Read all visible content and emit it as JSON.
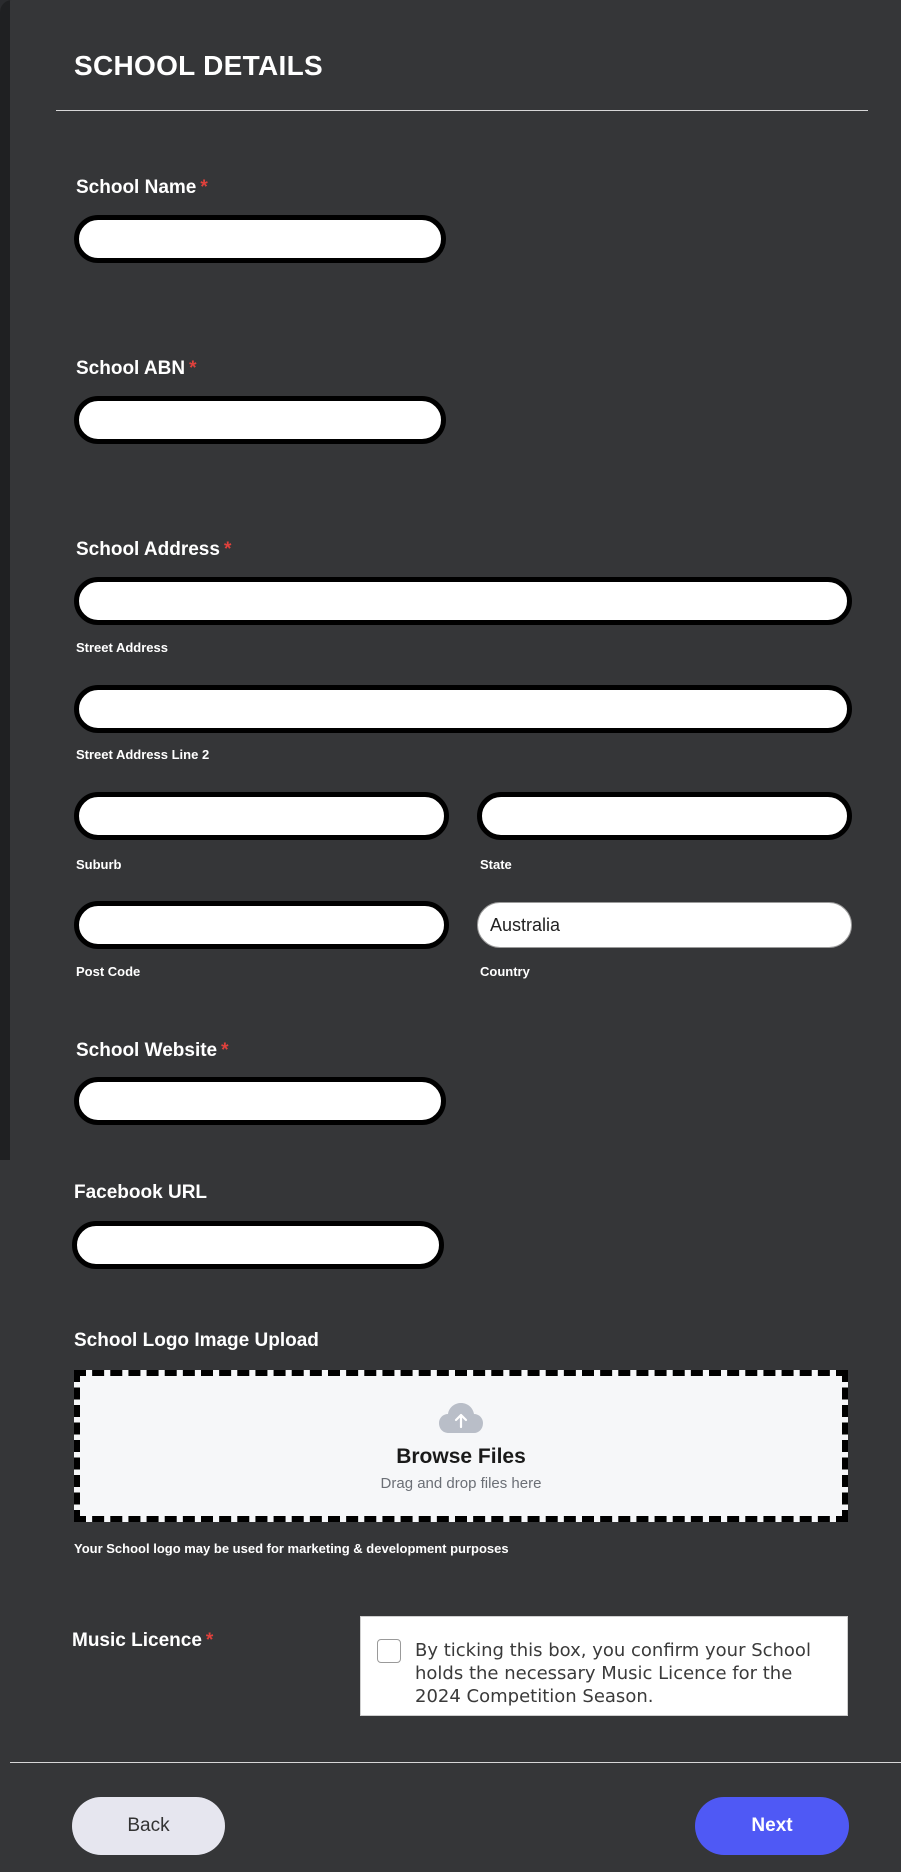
{
  "section": {
    "title": "SCHOOL DETAILS"
  },
  "school_name": {
    "label": "School Name",
    "required": "*",
    "value": ""
  },
  "school_abn": {
    "label": "School ABN",
    "required": "*",
    "value": ""
  },
  "school_address": {
    "label": "School Address",
    "required": "*",
    "street_label": "Street Address",
    "street2_label": "Street Address Line 2",
    "suburb_label": "Suburb",
    "state_label": "State",
    "postcode_label": "Post Code",
    "country_label": "Country",
    "country_value": "Australia"
  },
  "school_website": {
    "label": "School Website",
    "required": "*",
    "value": ""
  },
  "facebook_url": {
    "label": "Facebook URL",
    "value": ""
  },
  "logo_upload": {
    "label": "School Logo Image Upload",
    "browse_label": "Browse Files",
    "drag_label": "Drag and drop files here",
    "note": "Your School logo may be used for marketing & development purposes",
    "icon": "cloud-upload-icon"
  },
  "music_licence": {
    "label": "Music Licence",
    "required": "*",
    "checkbox_text": "By ticking this box, you confirm your School holds the necessary Music Licence for the 2024 Competition Season."
  },
  "footer": {
    "back_label": "Back",
    "next_label": "Next"
  },
  "colors": {
    "background": "#353638",
    "required": "#e0413c",
    "next_button": "#4f59f5",
    "back_button": "#e6e6ef"
  }
}
